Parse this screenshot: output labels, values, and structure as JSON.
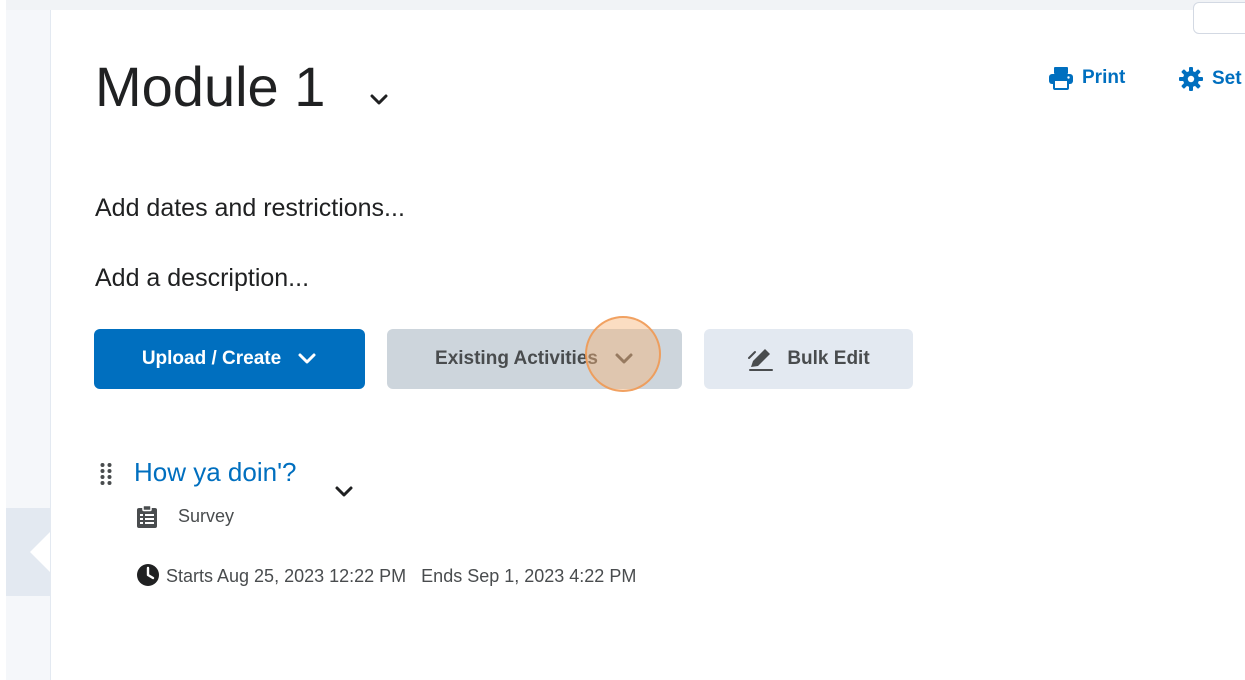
{
  "module": {
    "title": "Module 1"
  },
  "toolbar": {
    "print_label": "Print",
    "settings_label": "Set"
  },
  "meta": {
    "dates_link": "Add dates and restrictions...",
    "description_link": "Add a description..."
  },
  "actions": {
    "upload_create": "Upload / Create",
    "existing_activities": "Existing Activities",
    "bulk_edit": "Bulk Edit"
  },
  "activity": {
    "title": "How ya doin'?",
    "type": "Survey",
    "starts": "Starts Aug 25, 2023 12:22 PM",
    "ends": "Ends Sep 1, 2023 4:22 PM"
  },
  "colors": {
    "accent": "#006fbf",
    "secondary_button": "#cdd5dc",
    "tertiary_button": "#e3e9f1",
    "click_highlight": "#f7b478"
  },
  "icons": {
    "print": "printer-icon",
    "settings": "gear-icon",
    "bulk_edit": "pencil-icon",
    "drag": "drag-handle-icon",
    "type": "survey-icon",
    "dates": "clock-icon",
    "expand": "chevron-down-icon"
  }
}
